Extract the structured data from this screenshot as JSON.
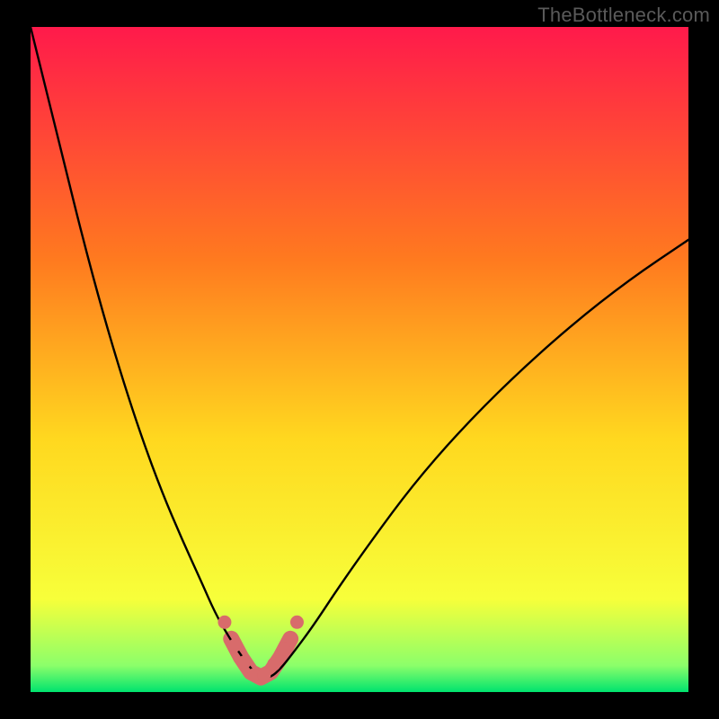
{
  "watermark": "TheBottleneck.com",
  "colors": {
    "bg": "#000000",
    "grad_top": "#ff1a4b",
    "grad_mid1": "#ff7a1f",
    "grad_mid2": "#ffd81f",
    "grad_mid3": "#f7ff3a",
    "grad_low": "#8cff6a",
    "grad_bottom": "#00e36e",
    "curve": "#000000",
    "marker_stroke": "#d86b6b",
    "marker_fill": "#d86b6b"
  },
  "chart_data": {
    "type": "line",
    "title": "",
    "xlabel": "",
    "ylabel": "",
    "xlim": [
      0,
      100
    ],
    "ylim": [
      0,
      100
    ],
    "series": [
      {
        "name": "bottleneck-curve",
        "x": [
          0,
          2,
          5,
          8,
          11,
          14,
          17,
          20,
          23,
          26,
          28,
          30,
          32,
          33.5,
          35,
          36.5,
          38,
          40,
          43,
          47,
          52,
          58,
          65,
          73,
          82,
          91,
          100
        ],
        "y": [
          100,
          92,
          80,
          68,
          57,
          47,
          38,
          30,
          23,
          16.5,
          12,
          8.5,
          5.5,
          3.5,
          2.2,
          2.2,
          3.5,
          6,
          10,
          16,
          23,
          31,
          39,
          47,
          55,
          62,
          68
        ]
      }
    ],
    "markers": {
      "name": "highlight-dots",
      "x": [
        29.5,
        31,
        32.5,
        34,
        35.5,
        37,
        38.5,
        40.5
      ],
      "y": [
        10.5,
        7,
        4.5,
        2.6,
        2.6,
        4.2,
        6.5,
        10.5
      ]
    },
    "thick_segment": {
      "name": "highlight-band",
      "x": [
        30.5,
        32,
        33.5,
        35,
        36.5,
        38,
        39.5
      ],
      "y": [
        8,
        5.2,
        3,
        2.2,
        3,
        5.2,
        8
      ]
    }
  }
}
